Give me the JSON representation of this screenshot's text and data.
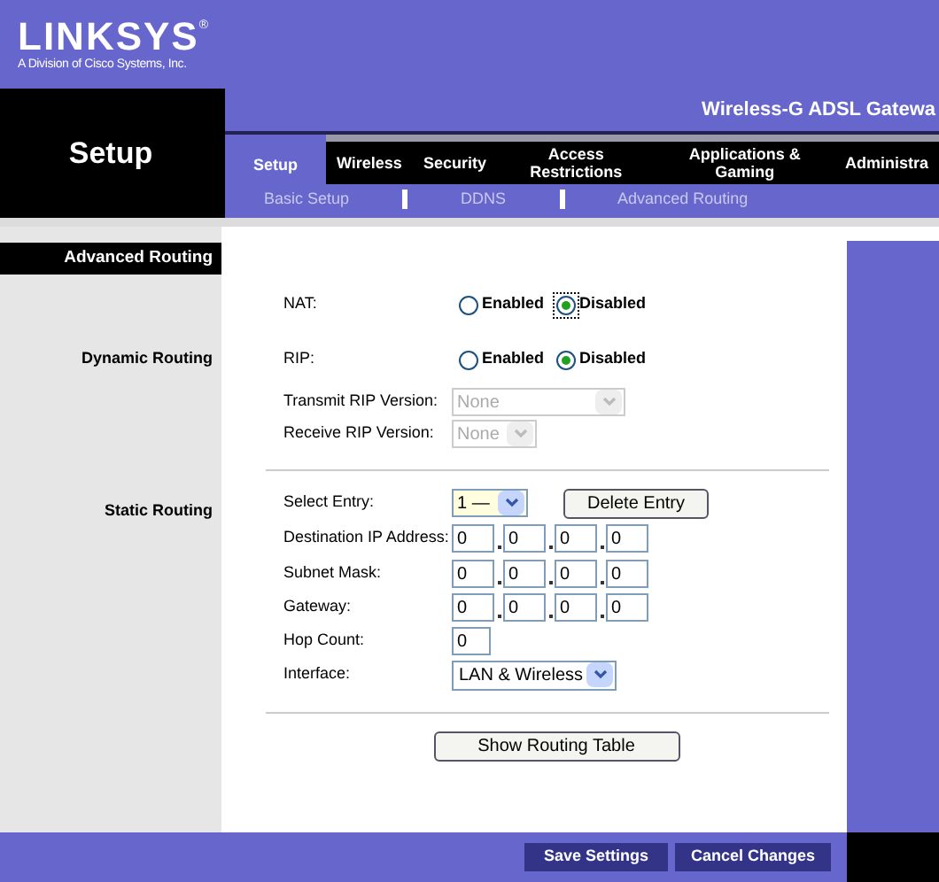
{
  "brand": {
    "logo": "LINKSYS",
    "registered": "®",
    "tagline": "A Division of Cisco Systems, Inc."
  },
  "section_title": "Setup",
  "product_name": "Wireless-G ADSL Gatewa",
  "tabs": [
    {
      "label": "Setup",
      "selected": true
    },
    {
      "label": "Wireless",
      "selected": false
    },
    {
      "label": "Security",
      "selected": false
    },
    {
      "label": "Access Restrictions",
      "selected": false
    },
    {
      "label": "Applications & Gaming",
      "selected": false
    },
    {
      "label": "Administra",
      "selected": false
    }
  ],
  "subtabs": [
    "Basic Setup",
    "DDNS",
    "Advanced Routing"
  ],
  "sidebar": {
    "header": "Advanced Routing",
    "dynamic": "Dynamic Routing",
    "static": "Static Routing"
  },
  "dynamic_routing": {
    "radios": [
      {
        "label": "NAT:",
        "options": [
          {
            "label": "Enabled",
            "selected": false,
            "focused": false
          },
          {
            "label": "Disabled",
            "selected": true,
            "focused": true
          }
        ]
      },
      {
        "label": "RIP:",
        "options": [
          {
            "label": "Enabled",
            "selected": false,
            "focused": false
          },
          {
            "label": "Disabled",
            "selected": true,
            "focused": false
          }
        ]
      }
    ],
    "selects": [
      {
        "label": "Transmit RIP Version:",
        "value": "None",
        "disabled": true,
        "kind": "wide"
      },
      {
        "label": "Receive RIP Version:",
        "value": "None",
        "disabled": true,
        "kind": "narrow"
      }
    ]
  },
  "static_routing": {
    "select_entry": {
      "label": "Select Entry:",
      "value": "1 —"
    },
    "delete_button": "Delete Entry",
    "addresses": [
      {
        "label": "Destination IP Address:",
        "octets": [
          "0",
          "0",
          "0",
          "0"
        ]
      },
      {
        "label": "Subnet Mask:",
        "octets": [
          "0",
          "0",
          "0",
          "0"
        ]
      },
      {
        "label": "Gateway:",
        "octets": [
          "0",
          "0",
          "0",
          "0"
        ]
      }
    ],
    "hop_count": {
      "label": "Hop Count:",
      "value": "0"
    },
    "interface": {
      "label": "Interface:",
      "value": "LAN & Wireless"
    },
    "show_button": "Show Routing Table"
  },
  "footer_buttons": [
    "Save Settings",
    "Cancel Changes"
  ]
}
